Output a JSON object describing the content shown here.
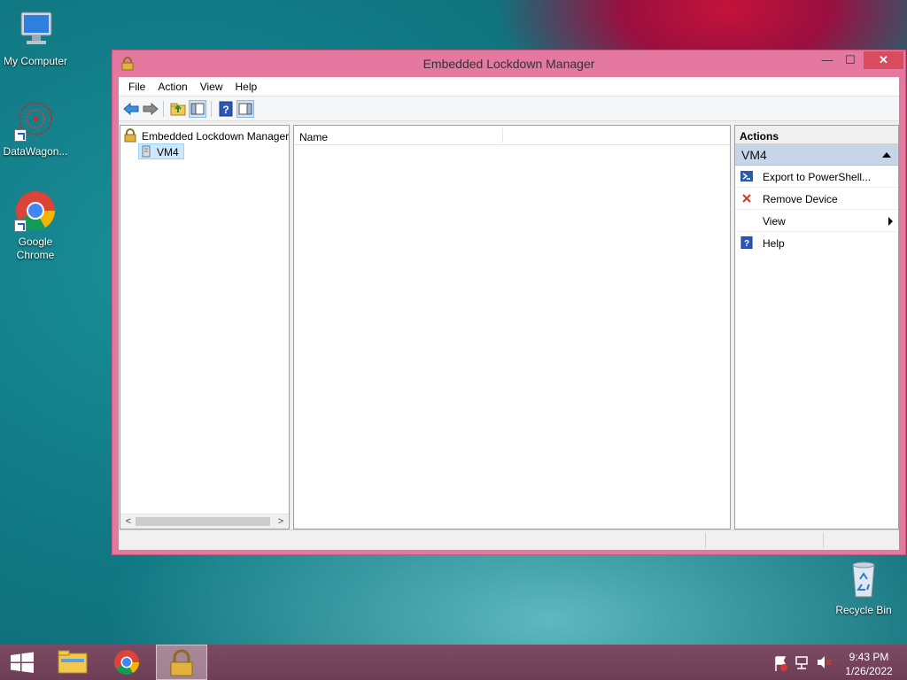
{
  "desktop": {
    "icons": [
      {
        "label": "My Computer"
      },
      {
        "label": "DataWagon..."
      },
      {
        "label": "Google Chrome"
      },
      {
        "label": "Recycle Bin"
      }
    ]
  },
  "window": {
    "title": "Embedded Lockdown Manager",
    "controls": {
      "minimize": "—",
      "maximize": "☐",
      "close": "✕"
    },
    "menu": [
      "File",
      "Action",
      "View",
      "Help"
    ],
    "toolbar": [
      {
        "icon": "back-arrow-icon"
      },
      {
        "icon": "forward-arrow-icon"
      },
      {
        "icon": "up-folder-icon"
      },
      {
        "icon": "show-hide-console-tree-icon"
      },
      {
        "icon": "help-icon"
      },
      {
        "icon": "show-hide-action-pane-icon"
      }
    ],
    "tree": {
      "root_label": "Embedded Lockdown Manager",
      "child_label": "VM4"
    },
    "list": {
      "column_name": "Name"
    },
    "actions": {
      "header": "Actions",
      "group_label": "VM4",
      "items": [
        {
          "label": "Export to PowerShell...",
          "icon": "powershell-icon"
        },
        {
          "label": "Remove Device",
          "icon": "red-x-icon"
        },
        {
          "label": "View",
          "icon": "",
          "submenu": true
        },
        {
          "label": "Help",
          "icon": "help-icon"
        }
      ]
    }
  },
  "taskbar": {
    "time": "9:43 PM",
    "date": "1/26/2022"
  },
  "colors": {
    "window_frame": "#e4789e",
    "close_button": "#d94b5e",
    "actions_group_bg": "#c6d5e8",
    "selection_bg": "#cce8ff",
    "taskbar": "#6e3e57"
  }
}
